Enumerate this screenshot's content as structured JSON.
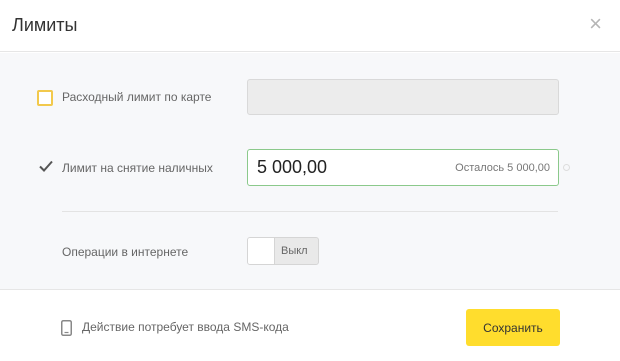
{
  "dialog": {
    "title": "Лимиты",
    "close_label": "×"
  },
  "limits": {
    "card_spend": {
      "label": "Расходный лимит по карте",
      "checked": false,
      "value": ""
    },
    "cash_withdrawal": {
      "label": "Лимит на снятие наличных",
      "checked": true,
      "value": "5 000,00",
      "remaining_hint": "Осталось 5 000,00"
    },
    "internet_operations": {
      "label": "Операции в интернете",
      "toggle_state": "Выкл"
    }
  },
  "footer": {
    "sms_note": "Действие потребует ввода SMS-кода",
    "save_label": "Сохранить"
  },
  "colors": {
    "accent_yellow": "#ffdd2d",
    "checkbox_border": "#f2c94c",
    "active_input_border": "#8bc98b"
  }
}
